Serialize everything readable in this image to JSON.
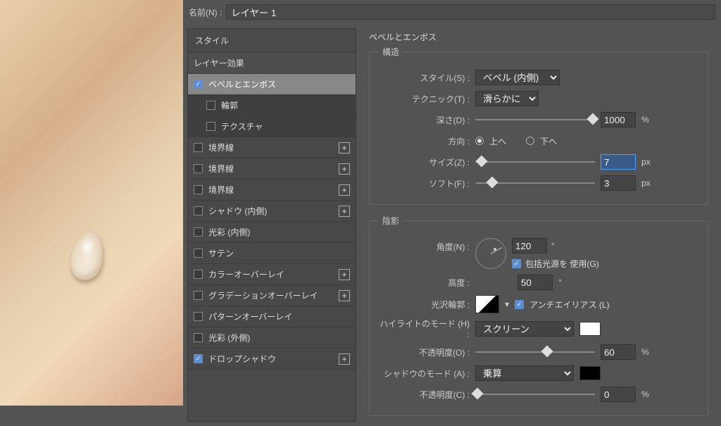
{
  "name_label": "名前(N) :",
  "name_value": "レイヤー 1",
  "styles_header": "スタイル",
  "styles": {
    "blending": "レイヤー効果",
    "bevel": "ベベルとエンボス",
    "contour": "輪郭",
    "texture": "テクスチャ",
    "stroke1": "境界線",
    "stroke2": "境界線",
    "stroke3": "境界線",
    "inner_shadow": "シャドウ (内側)",
    "inner_glow": "光彩 (内側)",
    "satin": "サテン",
    "color_overlay": "カラーオーバーレイ",
    "gradient_overlay": "グラデーションオーバーレイ",
    "pattern_overlay": "パターンオーバーレイ",
    "outer_glow": "光彩 (外側)",
    "drop_shadow": "ドロップシャドウ"
  },
  "bevel": {
    "title": "ベベルとエンボス",
    "structure": "構造",
    "style_lbl": "スタイル(S) :",
    "style_val": "ベベル (内側)",
    "technique_lbl": "テクニック(T) :",
    "technique_val": "滑らかに",
    "depth_lbl": "深さ(D) :",
    "depth_val": "1000",
    "depth_unit": "%",
    "direction_lbl": "方向 :",
    "dir_up": "上へ",
    "dir_down": "下へ",
    "size_lbl": "サイズ(Z) :",
    "size_val": "7",
    "size_unit": "px",
    "soften_lbl": "ソフト(F) :",
    "soften_val": "3",
    "soften_unit": "px"
  },
  "shade": {
    "title": "陰影",
    "angle_lbl": "角度(N) :",
    "angle_val": "120",
    "angle_unit": "°",
    "global_light": "包括光源を 使用(G)",
    "altitude_lbl": "高度 :",
    "altitude_val": "50",
    "altitude_unit": "°",
    "gloss_lbl": "光沢輪郭 :",
    "antialias": "アンチエイリアス (L)",
    "highlight_mode_lbl": "ハイライトのモード (H) :",
    "highlight_mode_val": "スクリーン",
    "opacity_lbl": "不透明度(O) :",
    "opacity_val": "60",
    "opacity_unit": "%",
    "shadow_mode_lbl": "シャドウのモード (A) :",
    "shadow_mode_val": "乗算",
    "opacity2_lbl": "不透明度(C) :",
    "opacity2_val": "0",
    "opacity2_unit": "%"
  }
}
